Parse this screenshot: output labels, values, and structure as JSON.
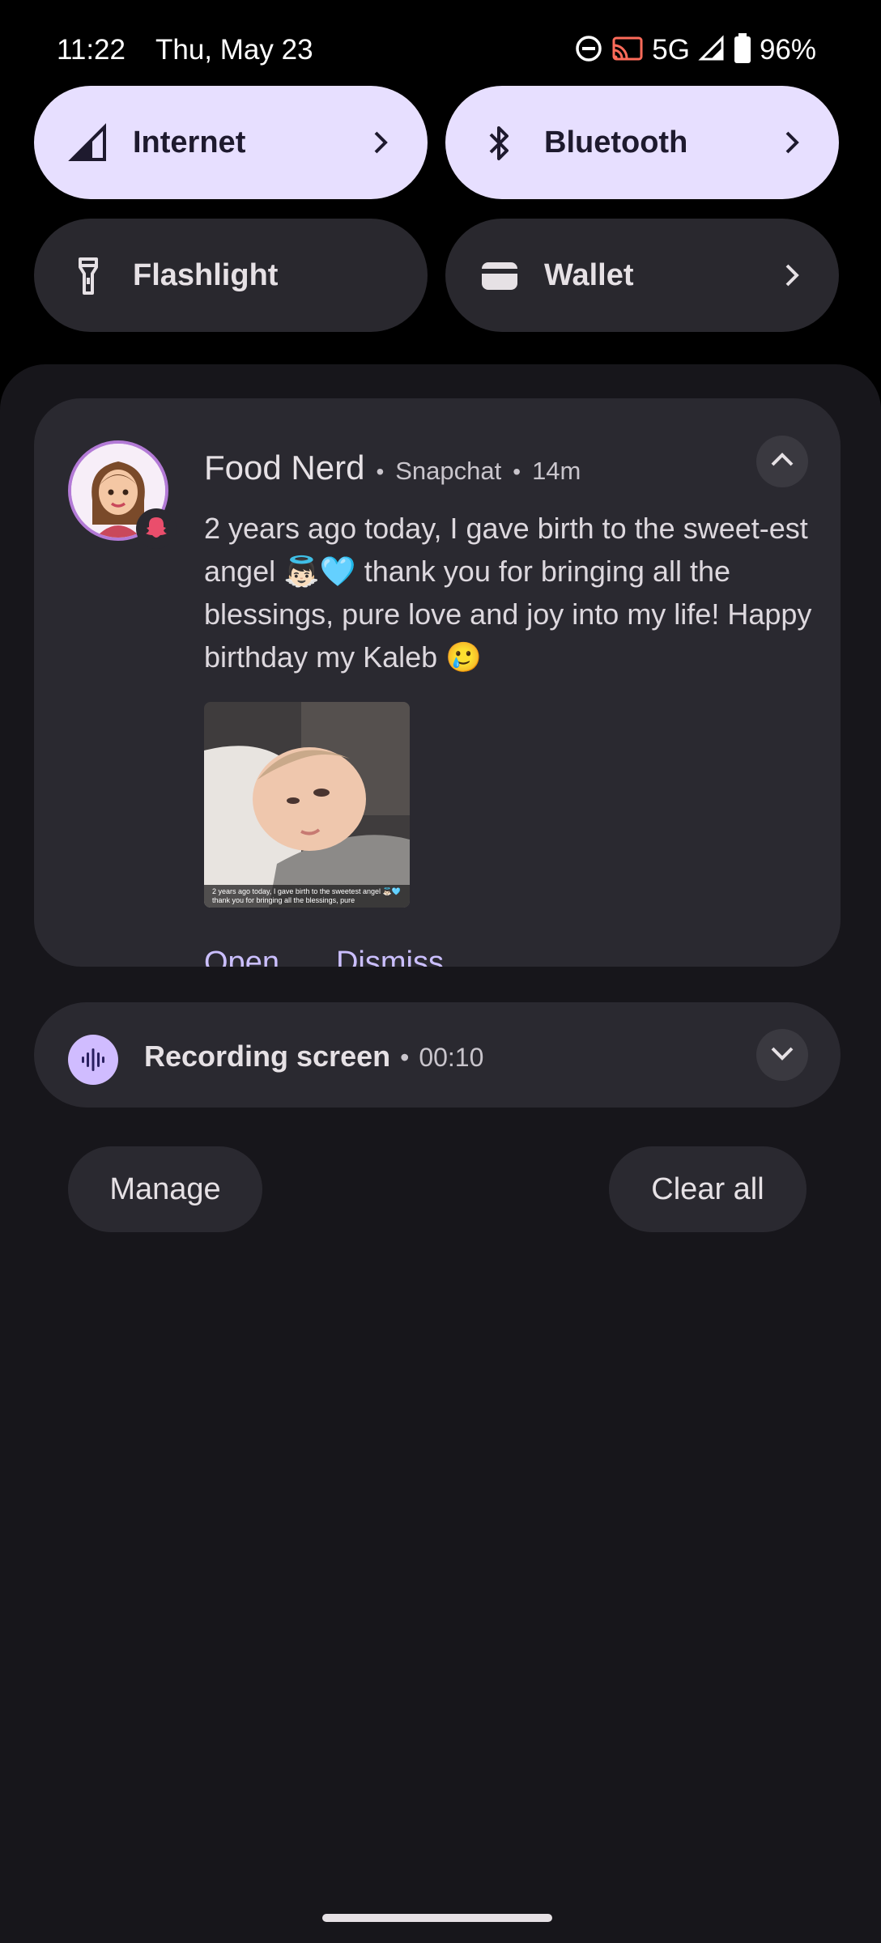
{
  "status_bar": {
    "time": "11:22",
    "date": "Thu, May 23",
    "network": "5G",
    "battery": "96%",
    "icons": [
      "dnd-icon",
      "cast-icon",
      "signal-icon",
      "battery-icon"
    ]
  },
  "quick_settings": {
    "tiles": [
      {
        "label": "Internet",
        "icon": "signal-icon",
        "state": "on"
      },
      {
        "label": "Bluetooth",
        "icon": "bluetooth-icon",
        "state": "on"
      },
      {
        "label": "Flashlight",
        "icon": "flashlight-icon",
        "state": "off"
      },
      {
        "label": "Wallet",
        "icon": "wallet-icon",
        "state": "off"
      }
    ]
  },
  "notification": {
    "title": "Food Nerd",
    "app": "Snapchat",
    "time": "14m",
    "body": "2 years ago today, I gave birth to the sweet-est angel 👼🏻🩵 thank you for bringing all the blessings, pure love and joy into my life! Happy birthday my Kaleb 🥲",
    "image_caption": "2 years ago today, I gave birth to the sweetest angel 👼🏻🩵 thank you for bringing all the blessings, pure",
    "actions": [
      "Open",
      "Dismiss"
    ]
  },
  "recording": {
    "title": "Recording screen",
    "elapsed": "00:10"
  },
  "footer": {
    "manage": "Manage",
    "clear_all": "Clear all"
  },
  "colors": {
    "tile_on": "#e7dfff",
    "tile_off": "#29282e",
    "shade": "#17161b",
    "card": "#2a2930",
    "accent": "#cbbfff",
    "snapchat_badge": "#ea4e6c"
  }
}
